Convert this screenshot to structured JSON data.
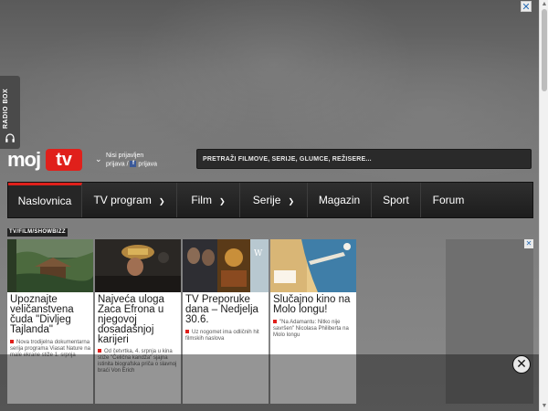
{
  "radio_box": {
    "label": "RADIO BOX",
    "icon": "headphones-icon"
  },
  "logo": {
    "moj": "moj",
    "tv": "tv"
  },
  "login": {
    "line1": "Nisi prijavljen",
    "line2_a": "prijava /",
    "fb_letter": "f",
    "line2_b": "prijava"
  },
  "search": {
    "placeholder": "PRETRAŽI FILMOVE, SERIJE, GLUMCE, REŽISERE..."
  },
  "nav": {
    "items": [
      {
        "label": "Naslovnica",
        "active": true,
        "dropdown": false
      },
      {
        "label": "TV program",
        "active": false,
        "dropdown": true
      },
      {
        "label": "Film",
        "active": false,
        "dropdown": true
      },
      {
        "label": "Serije",
        "active": false,
        "dropdown": true
      },
      {
        "label": "Magazin",
        "active": false,
        "dropdown": false
      },
      {
        "label": "Sport",
        "active": false,
        "dropdown": false
      },
      {
        "label": "Forum",
        "active": false,
        "dropdown": false
      }
    ]
  },
  "section_label": "TV/FILM/SHOWBIZZ",
  "cards": [
    {
      "title": "Upoznajte veličanstvena čuda \"Divljeg Tajlanda\"",
      "desc": "Nova trodijelna dokumentarna serija programa Viasat Nature na male ekrane stiže 1. srpnja"
    },
    {
      "title": "Najveća uloga Zaca Efrona u njegovoj dosadašnjoj karijeri",
      "desc": "Od četvrtka, 4. srpnja u kina stiže \"Čelična kandža\" sjajna istinita biografska priča o slavnoj braći Von Erich"
    },
    {
      "title": "TV Preporuke dana – Nedjelja 30.6.",
      "desc": "Uz nogomet ima odličnih hit filmskih naslova"
    },
    {
      "title": "Slučajno kino na Molo longu!",
      "desc": "\"Na Adamantu: Nitko nije savršen\" Nicolasa Philiberta na Molo longu"
    }
  ],
  "ad": {
    "close_glyph": "✕",
    "ad_mark": "✕"
  },
  "overlay": {
    "close_glyph": "✕"
  },
  "colors": {
    "brand_red": "#e0201b",
    "nav_bg": "#1d1d1d",
    "search_bg": "#2a2a2a"
  }
}
